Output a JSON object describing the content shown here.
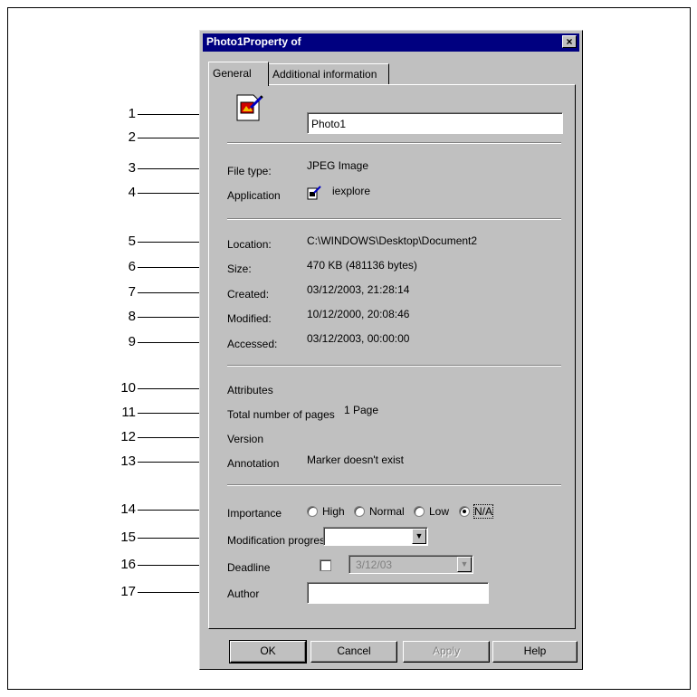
{
  "dialog": {
    "title": "Photo1Property of",
    "close_glyph": "×",
    "tabs": [
      {
        "label": "General",
        "active": true
      },
      {
        "label": "Additional information",
        "active": false
      }
    ]
  },
  "general": {
    "file_icon": "image-file-icon",
    "name_value": "Photo1",
    "file_type_label": "File type:",
    "file_type_value": "JPEG Image",
    "application_label": "Application",
    "application_icon": "iexplore-icon",
    "application_value": "iexplore",
    "location_label": "Location:",
    "location_value": "C:\\WINDOWS\\Desktop\\Document2",
    "size_label": "Size:",
    "size_value": "470 KB (481136 bytes)",
    "created_label": "Created:",
    "created_value": "03/12/2003, 21:28:14",
    "modified_label": "Modified:",
    "modified_value": "10/12/2000, 20:08:46",
    "accessed_label": "Accessed:",
    "accessed_value": "03/12/2003, 00:00:00",
    "attributes_label": "Attributes",
    "pages_label": "Total number of pages",
    "pages_value": "1 Page",
    "version_label": "Version",
    "annotation_label": "Annotation",
    "annotation_value": "Marker doesn't exist",
    "importance_label": "Importance",
    "importance_options": [
      "High",
      "Normal",
      "Low",
      "N/A"
    ],
    "importance_selected": "N/A",
    "modification_label": "Modification progress",
    "modification_value": "",
    "deadline_label": "Deadline",
    "deadline_checked": false,
    "deadline_value": "3/12/03",
    "author_label": "Author",
    "author_value": ""
  },
  "buttons": {
    "ok": "OK",
    "cancel": "Cancel",
    "apply": "Apply",
    "help": "Help"
  },
  "callouts": [
    "1",
    "2",
    "3",
    "4",
    "5",
    "6",
    "7",
    "8",
    "9",
    "10",
    "11",
    "12",
    "13",
    "14",
    "15",
    "16",
    "17"
  ],
  "colors": {
    "title_bar": "#000080",
    "dialog_bg": "#c0c0c0"
  }
}
